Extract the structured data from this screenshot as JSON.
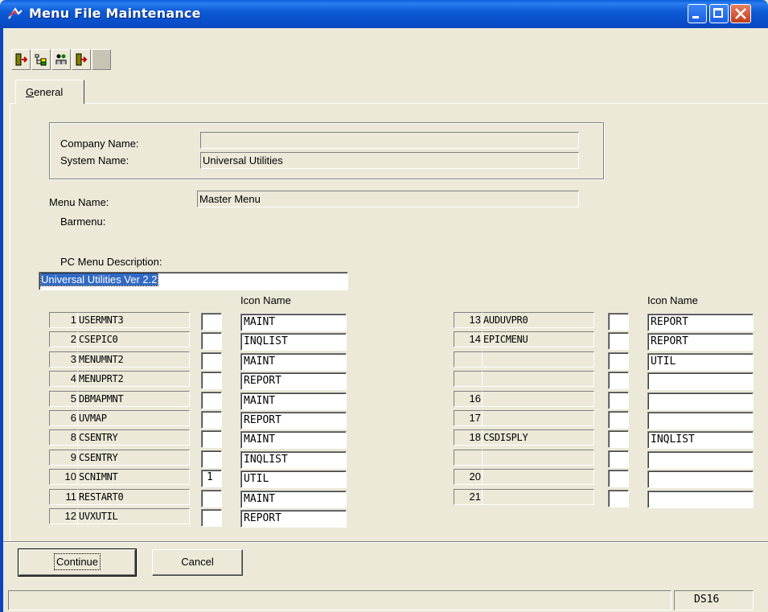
{
  "window": {
    "title": "Menu File Maintenance",
    "title_icon": "app-icon",
    "controls": [
      "minimize-icon",
      "maximize-icon",
      "close-icon"
    ],
    "accent_color": "#0A4FCB",
    "close_color": "#C23C1A",
    "face_color": "#ECE9D8"
  },
  "toolbar": {
    "buttons": [
      {
        "icon": "exit-door-icon"
      },
      {
        "icon": "tree-structure-icon"
      },
      {
        "icon": "users-tree-icon"
      },
      {
        "icon": "enter-door-icon"
      },
      {
        "icon": "disabled-blank-icon"
      }
    ]
  },
  "tabs": [
    {
      "label": "General",
      "accel": "G",
      "rest": "eneral"
    }
  ],
  "header": {
    "company_label": "Company Name:",
    "company_value": "",
    "system_label": "System Name:",
    "system_value": "Universal Utilities",
    "menu_label": "Menu Name:",
    "menu_value": "Master Menu",
    "barmenu_label": "Barmenu:",
    "pc_desc_label": "PC Menu Description:",
    "pc_desc_value": "Universal Utilities Ver 2.2"
  },
  "icon_name_header": "Icon Name",
  "left_rows": [
    {
      "num": "1",
      "name": "USERMNT3",
      "box": "",
      "icon": "MAINT"
    },
    {
      "num": "2",
      "name": "CSEPIC0",
      "box": "",
      "icon": "INQLIST"
    },
    {
      "num": "3",
      "name": "MENUMNT2",
      "box": "",
      "icon": "MAINT"
    },
    {
      "num": "4",
      "name": "MENUPRT2",
      "box": "",
      "icon": "REPORT"
    },
    {
      "num": "5",
      "name": "DBMAPMNT",
      "box": "",
      "icon": "MAINT"
    },
    {
      "num": "6",
      "name": "UVMAP",
      "box": "",
      "icon": "REPORT"
    },
    {
      "num": "8",
      "name": "CSENTRY",
      "box": "",
      "icon": "MAINT"
    },
    {
      "num": "9",
      "name": "CSENTRY",
      "box": "",
      "icon": "INQLIST"
    },
    {
      "num": "10",
      "name": "SCNIMNT",
      "box": "1",
      "icon": "UTIL"
    },
    {
      "num": "11",
      "name": "RESTART0",
      "box": "",
      "icon": "MAINT"
    },
    {
      "num": "12",
      "name": "UVXUTIL",
      "box": "",
      "icon": "REPORT"
    }
  ],
  "right_rows": [
    {
      "num": "13",
      "name": "AUDUVPR0",
      "box": "",
      "icon": "REPORT"
    },
    {
      "num": "14",
      "name": "EPICMENU",
      "box": "",
      "icon": "REPORT"
    },
    {
      "num": "",
      "name": "",
      "box": "",
      "icon": "UTIL"
    },
    {
      "num": "",
      "name": "",
      "box": "",
      "icon": ""
    },
    {
      "num": "16",
      "name": "",
      "box": "",
      "icon": ""
    },
    {
      "num": "17",
      "name": "",
      "box": "",
      "icon": ""
    },
    {
      "num": "18",
      "name": "CSDISPLY",
      "box": "",
      "icon": "INQLIST"
    },
    {
      "num": "",
      "name": "",
      "box": "",
      "icon": ""
    },
    {
      "num": "20",
      "name": "",
      "box": "",
      "icon": ""
    },
    {
      "num": "21",
      "name": "",
      "box": "",
      "icon": ""
    }
  ],
  "buttons": {
    "continue_label": "Continue",
    "cancel_label": "Cancel"
  },
  "status": {
    "main": "",
    "code": "DS16"
  }
}
